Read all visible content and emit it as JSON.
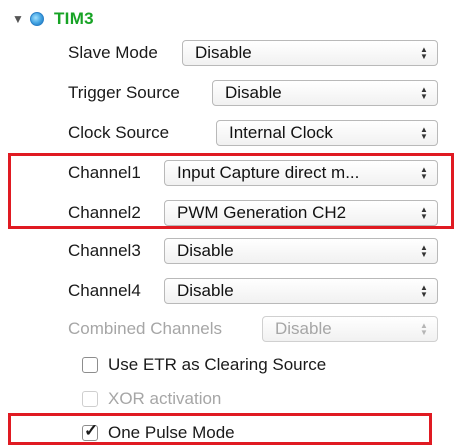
{
  "tree": {
    "expand_glyph": "▼",
    "title": "TIM3"
  },
  "fields": [
    {
      "label": "Slave Mode",
      "value": "Disable",
      "enabled": true
    },
    {
      "label": "Trigger Source",
      "value": "Disable",
      "enabled": true
    },
    {
      "label": "Clock Source",
      "value": "Internal Clock",
      "enabled": true
    },
    {
      "label": "Channel1",
      "value": "Input Capture direct m...",
      "enabled": true
    },
    {
      "label": "Channel2",
      "value": "PWM Generation CH2",
      "enabled": true
    },
    {
      "label": "Channel3",
      "value": "Disable",
      "enabled": true
    },
    {
      "label": "Channel4",
      "value": "Disable",
      "enabled": true
    },
    {
      "label": "Combined Channels",
      "value": "Disable",
      "enabled": false
    }
  ],
  "checkboxes": [
    {
      "label": "Use ETR as Clearing Source",
      "checked": false,
      "enabled": true
    },
    {
      "label": "XOR activation",
      "checked": false,
      "enabled": false
    },
    {
      "label": "One Pulse Mode",
      "checked": true,
      "enabled": true
    }
  ],
  "colors": {
    "title_green": "#17a325",
    "highlight_red": "#e01a22",
    "disabled_gray": "#a6a6a6"
  },
  "icons": {
    "stepper": "up-down-stepper-icon",
    "peripheral": "chip-icon",
    "tree_toggle": "triangle-down-icon"
  }
}
